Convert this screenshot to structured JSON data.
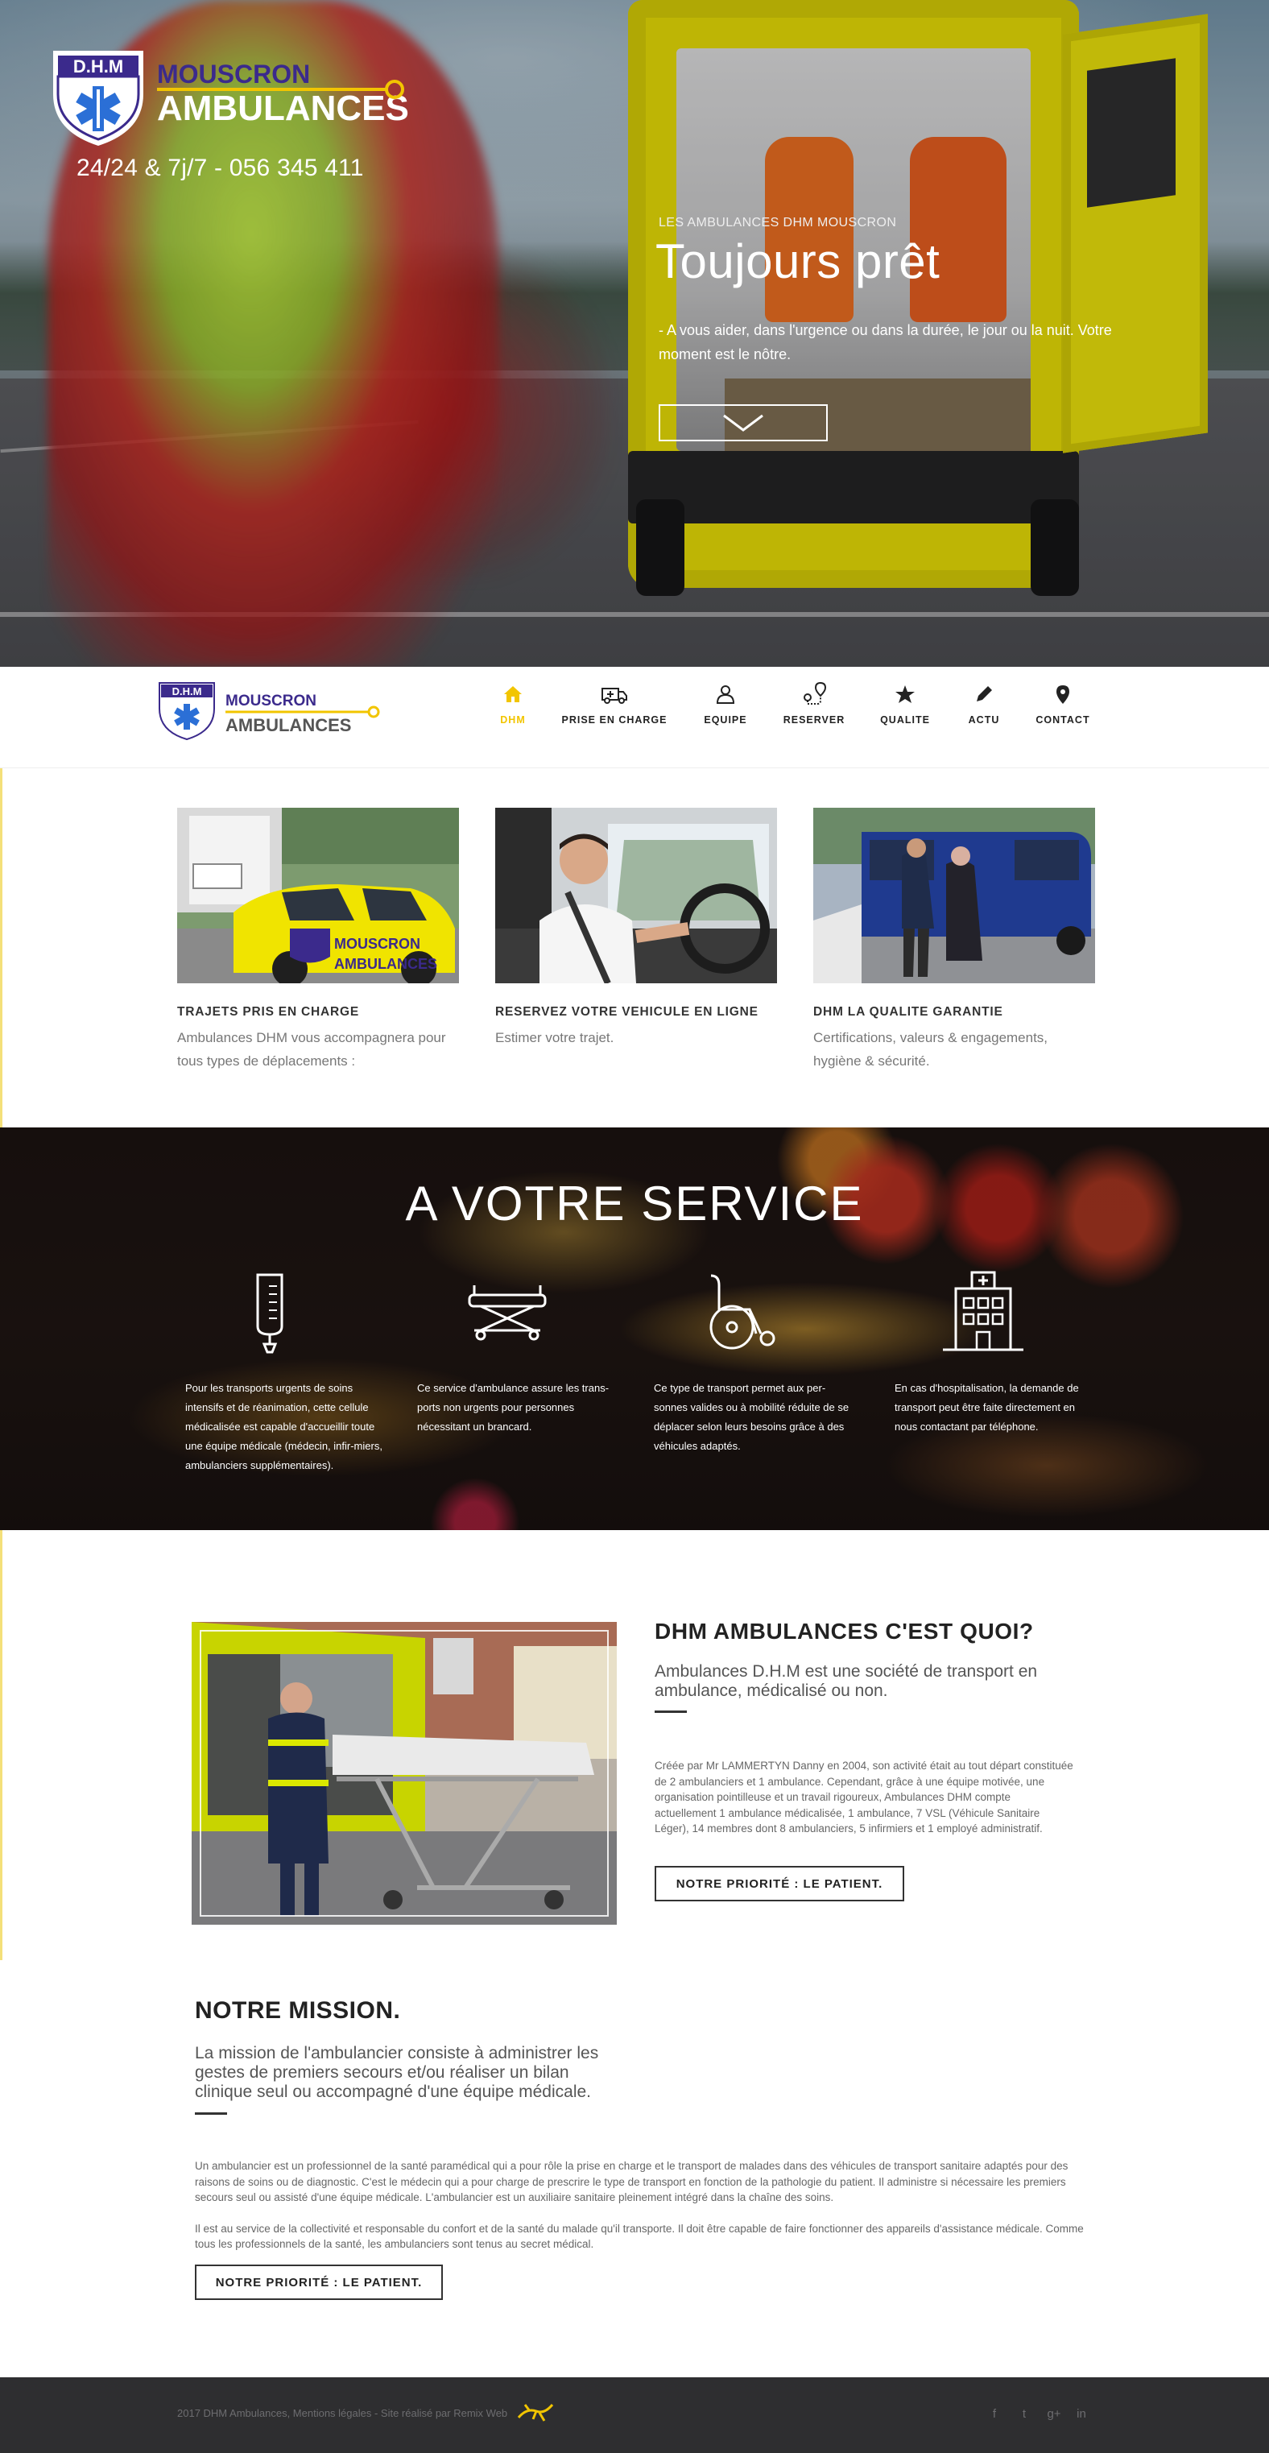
{
  "brand": {
    "badge_text": "D.H.M",
    "name_line1": "MOUSCRON",
    "name_line2": "AMBULANCES",
    "colors": {
      "purple": "#3b2a8c",
      "yellow": "#f2c500",
      "dark": "#2e2e30"
    }
  },
  "hero": {
    "phone": "24/24 & 7j/7  - 056 345 411",
    "eyebrow": "LES AMBULANCES DHM MOUSCRON",
    "title": "Toujours prêt",
    "text": "- A vous aider, dans l'urgence ou dans la durée, le jour ou la nuit. Votre moment est le nôtre.",
    "scroll_icon": "chevron-down-icon"
  },
  "nav": {
    "items": [
      {
        "label": "DHM",
        "icon": "home-icon"
      },
      {
        "label": "PRISE EN CHARGE",
        "icon": "ambulance-icon"
      },
      {
        "label": "EQUIPE",
        "icon": "user-icon"
      },
      {
        "label": "RESERVER",
        "icon": "route-pin-icon"
      },
      {
        "label": "QUALITE",
        "icon": "star-icon"
      },
      {
        "label": "ACTU",
        "icon": "pencil-icon"
      },
      {
        "label": "CONTACT",
        "icon": "map-pin-icon"
      }
    ]
  },
  "features": [
    {
      "title": "TRAJETS PRIS EN CHARGE",
      "text": "Ambulances DHM vous accompagnera pour tous types de déplacements :"
    },
    {
      "title": "RESERVEZ VOTRE  VEHICULE EN LIGNE",
      "text": "Estimer votre trajet."
    },
    {
      "title": "DHM LA QUALITE GARANTIE",
      "text": "Certifications, valeurs & engagements, hygiène & sécurité."
    }
  ],
  "service": {
    "title": "A VOTRE SERVICE",
    "items": [
      {
        "icon": "iv-drip-icon",
        "text": "Pour les transports urgents de soins intensifs et de réanimation, cette cellule médicalisée est capable d'accueillir toute une équipe médicale (médecin, infir-miers, ambulanciers supplémentaires)."
      },
      {
        "icon": "stretcher-icon",
        "text": "Ce service d'ambulance assure les trans-ports non urgents pour personnes nécessitant un brancard."
      },
      {
        "icon": "wheelchair-icon",
        "text": "Ce type de transport permet aux per-sonnes valides ou à mobilité réduite de se déplacer selon leurs besoins grâce à des véhicules adaptés."
      },
      {
        "icon": "hospital-icon",
        "text": "En cas d'hospitalisation, la demande de transport peut être faite directement en nous contactant par téléphone."
      }
    ]
  },
  "about": {
    "title": "DHM AMBULANCES C'EST QUOI?",
    "lead": "Ambulances D.H.M est une société de transport en ambulance, médicalisé ou non.",
    "body": "Créée par Mr LAMMERTYN Danny en 2004, son activité était au tout départ constituée de  2 ambulanciers et 1 ambulance.  Cependant, grâce à une équipe motivée, une organisation pointilleuse et un travail rigoureux, Ambulances DHM compte actuellement 1 ambulance médicalisée, 1 ambulance, 7 VSL (Véhicule Sanitaire Léger), 14 membres dont 8 ambulanciers, 5 infirmiers et 1  employé administratif.",
    "button": "NOTRE PRIORITÉ : LE PATIENT."
  },
  "mission": {
    "title": "NOTRE MISSION.",
    "lead": "La mission de l'ambulancier consiste à administrer les gestes de premiers secours et/ou réaliser un bilan clinique seul ou accompagné d'une équipe médicale.",
    "para1": "Un ambulancier est un professionnel de la santé paramédical qui a pour rôle la prise en charge et le transport de malades dans des véhicules de transport sanitaire adaptés pour des raisons de soins ou de diagnostic. C'est le médecin qui a pour charge de prescrire le type de transport en fonction de la pathologie du patient. Il administre si nécessaire les premiers secours seul ou assisté d'une équipe médicale. L'ambulancier est un auxiliaire sanitaire pleinement intégré dans la chaîne des soins.",
    "para2": "Il est au service de la collectivité et responsable du confort et de la santé du malade qu'il transporte. Il doit être capable de faire fonctionner des appareils d'assistance médicale. Comme tous les professionnels de la santé, les ambulanciers sont tenus au secret médical.",
    "button": "NOTRE PRIORITÉ : LE PATIENT."
  },
  "footer": {
    "copyright": "2017 DHM Ambulances, Mentions légales - Site réalisé par Remix Web",
    "social": [
      {
        "glyph": "f",
        "icon": "facebook-icon"
      },
      {
        "glyph": "t",
        "icon": "twitter-icon"
      },
      {
        "glyph": "g+",
        "icon": "google-plus-icon"
      },
      {
        "glyph": "in",
        "icon": "linkedin-icon"
      }
    ]
  }
}
